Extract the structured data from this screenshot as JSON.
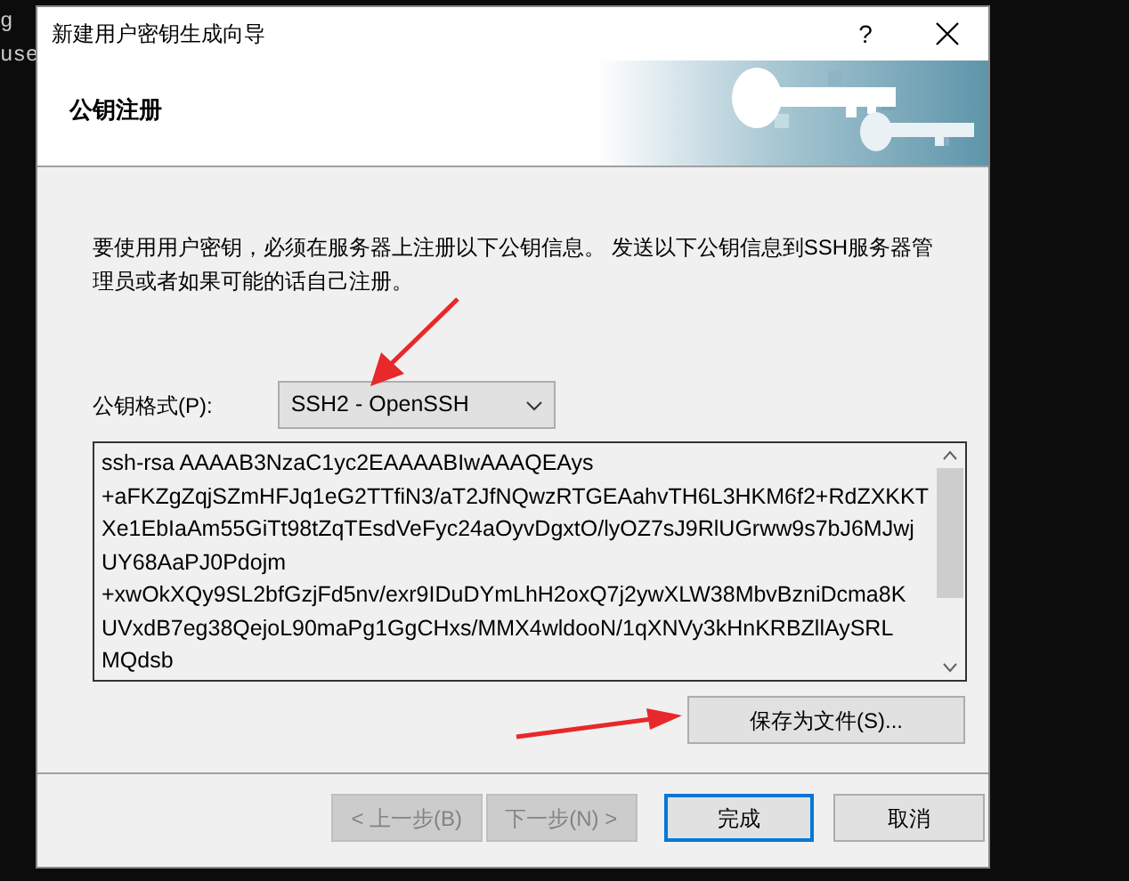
{
  "terminal": {
    "lines": [
      "g",
      "use"
    ]
  },
  "window": {
    "title": "新建用户密钥生成向导",
    "help": "?"
  },
  "header": {
    "title": "公钥注册"
  },
  "description": "要使用用户密钥，必须在服务器上注册以下公钥信息。 发送以下公钥信息到SSH服务器管理员或者如果可能的话自己注册。",
  "format": {
    "label": "公钥格式(P):",
    "value": "SSH2 - OpenSSH"
  },
  "key_lines": [
    "ssh-rsa AAAAB3NzaC1yc2EAAAABIwAAAQEAys",
    "+aFKZgZqjSZmHFJq1eG2TTfiN3/aT2JfNQwzRTGEAahvTH6L3HKM6f2+RdZXKKT",
    "Xe1EbIaAm55GiTt98tZqTEsdVeFyc24aOyvDgxtO/lyOZ7sJ9RlUGrww9s7bJ6MJwj",
    "UY68AaPJ0Pdojm",
    "+xwOkXQy9SL2bfGzjFd5nv/exr9IDuDYmLhH2oxQ7j2ywXLW38MbvBzniDcma8K",
    "UVxdB7eg38QejoL90maPg1GgCHxs/MMX4wldooN/1qXNVy3kHnKRBZllAySRL",
    "MQdsb"
  ],
  "save_button": "保存为文件(S)...",
  "buttons": [
    {
      "label": "< 上一步(B)",
      "disabled": true,
      "default": false
    },
    {
      "label": "下一步(N) >",
      "disabled": true,
      "default": false
    },
    {
      "label": "完成",
      "disabled": false,
      "default": true
    },
    {
      "label": "取消",
      "disabled": false,
      "default": false
    }
  ]
}
